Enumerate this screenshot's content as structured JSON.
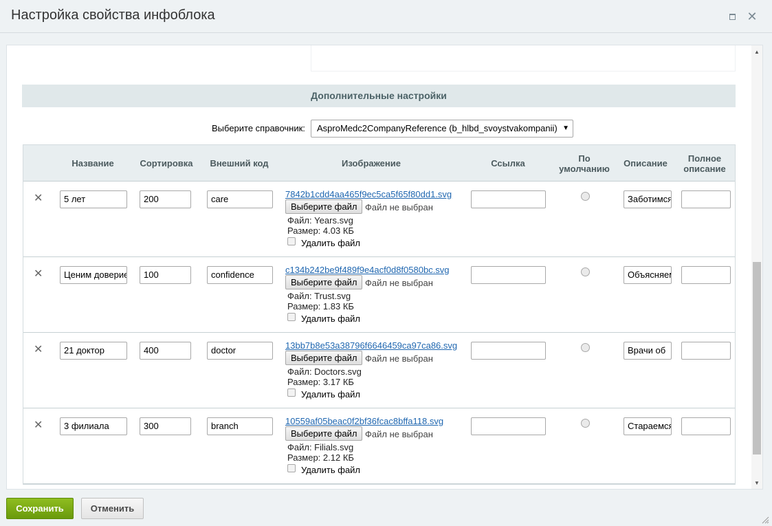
{
  "window": {
    "title": "Настройка свойства инфоблока"
  },
  "section": {
    "title": "Дополнительные настройки"
  },
  "reference": {
    "label": "Выберите справочник:",
    "selected": "AsproMedc2CompanyReference (b_hlbd_svoystvakompanii)"
  },
  "table": {
    "headers": {
      "name": "Название",
      "sort": "Сортировка",
      "xml_id": "Внешний код",
      "image": "Изображение",
      "link": "Ссылка",
      "default_line1": "По",
      "default_line2": "умолчанию",
      "description": "Описание",
      "full_line1": "Полное",
      "full_line2": "описание"
    },
    "rows": [
      {
        "name": "5 лет",
        "sort": "200",
        "xml_id": "care",
        "file_link": "7842b1cdd4aa465f9ec5ca5f65f80dd1.svg",
        "file_name": "Файл: Years.svg",
        "file_size": "Размер: 4.03 КБ",
        "link": "",
        "description": "Заботимся",
        "full_description": ""
      },
      {
        "name": "Ценим доверие",
        "sort": "100",
        "xml_id": "confidence",
        "file_link": "c134b242be9f489f9e4acf0d8f0580bc.svg",
        "file_name": "Файл: Trust.svg",
        "file_size": "Размер: 1.83 КБ",
        "link": "",
        "description": "Объясняем",
        "full_description": ""
      },
      {
        "name": "21 доктор",
        "sort": "400",
        "xml_id": "doctor",
        "file_link": "13bb7b8e53a38796f6646459ca97ca86.svg",
        "file_name": "Файл: Doctors.svg",
        "file_size": "Размер: 3.17 КБ",
        "link": "",
        "description": "Врачи об",
        "full_description": ""
      },
      {
        "name": "3 филиала",
        "sort": "300",
        "xml_id": "branch",
        "file_link": "10559af05beac0f2bf36fcac8bffa118.svg",
        "file_name": "Файл: Filials.svg",
        "file_size": "Размер: 2.12 КБ",
        "link": "",
        "description": "Стараемся",
        "full_description": ""
      }
    ],
    "choose_file_label": "Выберите файл",
    "no_file_label": "Файл не выбран",
    "delete_file_label": "Удалить файл",
    "delete_row_glyph": "✕"
  },
  "buttons": {
    "save": "Сохранить",
    "cancel": "Отменить"
  },
  "icons": {
    "close": "close-icon",
    "maximize": "maximize-icon",
    "dropdown": "chevron-down-icon",
    "resize": "resize-grip-icon"
  }
}
